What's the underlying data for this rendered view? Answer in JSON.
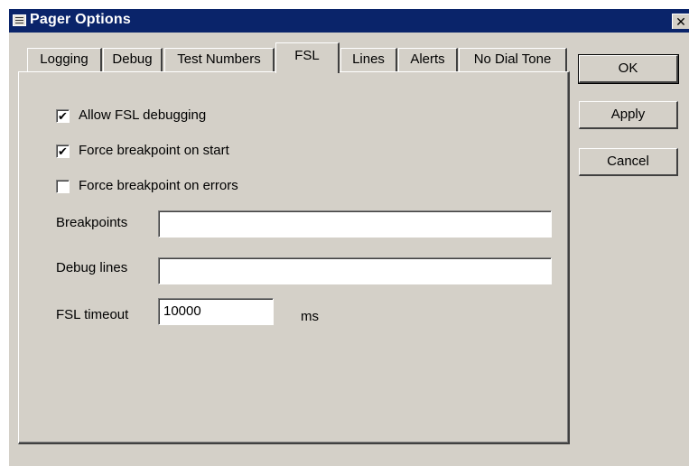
{
  "window": {
    "title": "Pager Options",
    "close_glyph": "✕",
    "icon": "pager-icon"
  },
  "tabs": [
    {
      "label": "Logging"
    },
    {
      "label": "Debug"
    },
    {
      "label": "Test Numbers"
    },
    {
      "label": "FSL",
      "active": true
    },
    {
      "label": "Lines"
    },
    {
      "label": "Alerts"
    },
    {
      "label": "No Dial Tone"
    }
  ],
  "fsl": {
    "allow_debugging": {
      "label": "Allow FSL debugging",
      "checked": true
    },
    "break_on_start": {
      "label": "Force breakpoint on start",
      "checked": true
    },
    "break_on_errors": {
      "label": "Force breakpoint on errors",
      "checked": false
    },
    "breakpoints": {
      "label": "Breakpoints",
      "value": ""
    },
    "debug_lines": {
      "label": "Debug lines",
      "value": ""
    },
    "timeout": {
      "label": "FSL timeout",
      "value": "10000",
      "unit": "ms"
    }
  },
  "buttons": {
    "ok": "OK",
    "apply": "Apply",
    "cancel": "Cancel"
  }
}
